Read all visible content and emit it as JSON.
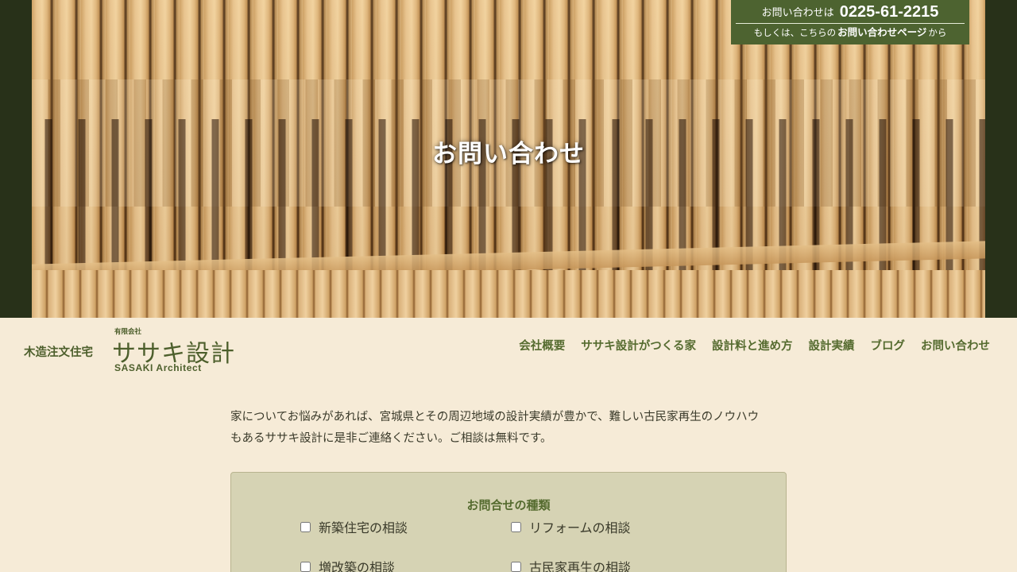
{
  "hero": {
    "title": "お問い合わせ"
  },
  "contact_box": {
    "prefix": "お問い合わせは",
    "phone": "0225-61-2215",
    "line2_before": "もしくは、こちらの",
    "link_label": "お問い合わせページ",
    "line2_after": "から"
  },
  "logo": {
    "tagline": "木造注文住宅",
    "company_kind": "有限会社",
    "name": "ササキ設計",
    "english": "SASAKI Architect"
  },
  "nav": {
    "items": [
      "会社概要",
      "ササキ設計がつくる家",
      "設計料と進め方",
      "設計実績",
      "ブログ",
      "お問い合わせ"
    ]
  },
  "intro": {
    "line1": "家についてお悩みがあれば、宮城県とその周辺地域の設計実績が豊かで、難しい古民家再生のノウハウ",
    "line2": "もあるササキ設計に是非ご連絡ください。ご相談は無料です。"
  },
  "form": {
    "legend": "お問合せの種類",
    "options": [
      "新築住宅の相談",
      "リフォームの相談",
      "増改築の相談",
      "古民家再生の相談"
    ],
    "checked": [
      false,
      false,
      false,
      false
    ]
  },
  "colors": {
    "brand_green": "#556b2f",
    "hero_bg": "#283119",
    "page_bg": "#f6ebd7",
    "contact_bg": "#4d6330",
    "form_bg": "#d6d3b4"
  }
}
